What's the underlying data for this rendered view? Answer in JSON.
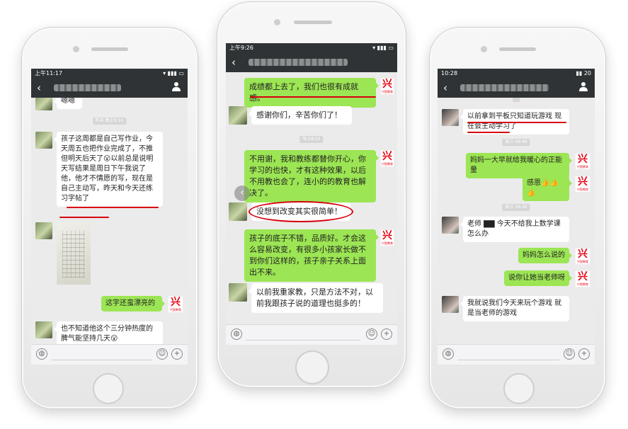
{
  "left_phone": {
    "status_time": "上午11:17",
    "messages": {
      "m0": "嗯嗯",
      "ts1": "昨天 晚上9:16",
      "m1": "孩子这周都是自己写作业，今天周五也把作业完成了，不推但明天后天了😮以前总是说明天写结果是周日下午我说了他，他才不情愿的写，现在是自己主动写，昨天和今天还练习字帖了",
      "m3": "这字还蛮漂亮的",
      "m4": "也不知道他这个三分钟热度的脾气能坚持几天😮"
    },
    "brand_logo": "兴",
    "brand_name": "兴智教育"
  },
  "middle_phone": {
    "status_time": "上午9:26",
    "messages": {
      "m1": "成绩都上去了，我们也很有成就感。",
      "m2": "感谢你们，辛苦你们了！",
      "ts1": "早上8:23",
      "m3": "不用谢，我和教练都替你开心，你学习的也快，才有这种效果，以后不用教也会了，连小的的教育也解决了。",
      "m4": "没想到改变其实很简单！",
      "m5": "孩子的底子不错，品质好。才会这么容易改变，有很多小孩家长做不到你们这样的，孩子亲子关系上面出不来。",
      "m6": "以前我重家教，只是方法不对，以前我跟孩子说的道理也挺多的！"
    },
    "brand_logo": "兴",
    "brand_name": "兴智教育"
  },
  "right_phone": {
    "status_time": "10:28",
    "battery": "20",
    "messages": {
      "m1": "以前拿到平板只知道玩游戏  现在会主动学习了",
      "ts1": "周三 09:46",
      "m2": "妈妈一大早就给我暖心的正能量",
      "m3": "感恩👍👍👍",
      "ts2": "周三 16:36",
      "m4": "老师 ▇▇ 今天不给我上数学课怎么办",
      "m5": "妈妈怎么说的",
      "m6": "说你让她当老师呀",
      "m7": "我就说我们今天来玩个游戏  就是当老师的游戏"
    },
    "brand_logo": "兴",
    "brand_name": "兴智教育"
  },
  "icons": {
    "back": "‹",
    "voice": "◍",
    "emoji": "☺",
    "plus": "+",
    "carousel_prev": "‹"
  }
}
